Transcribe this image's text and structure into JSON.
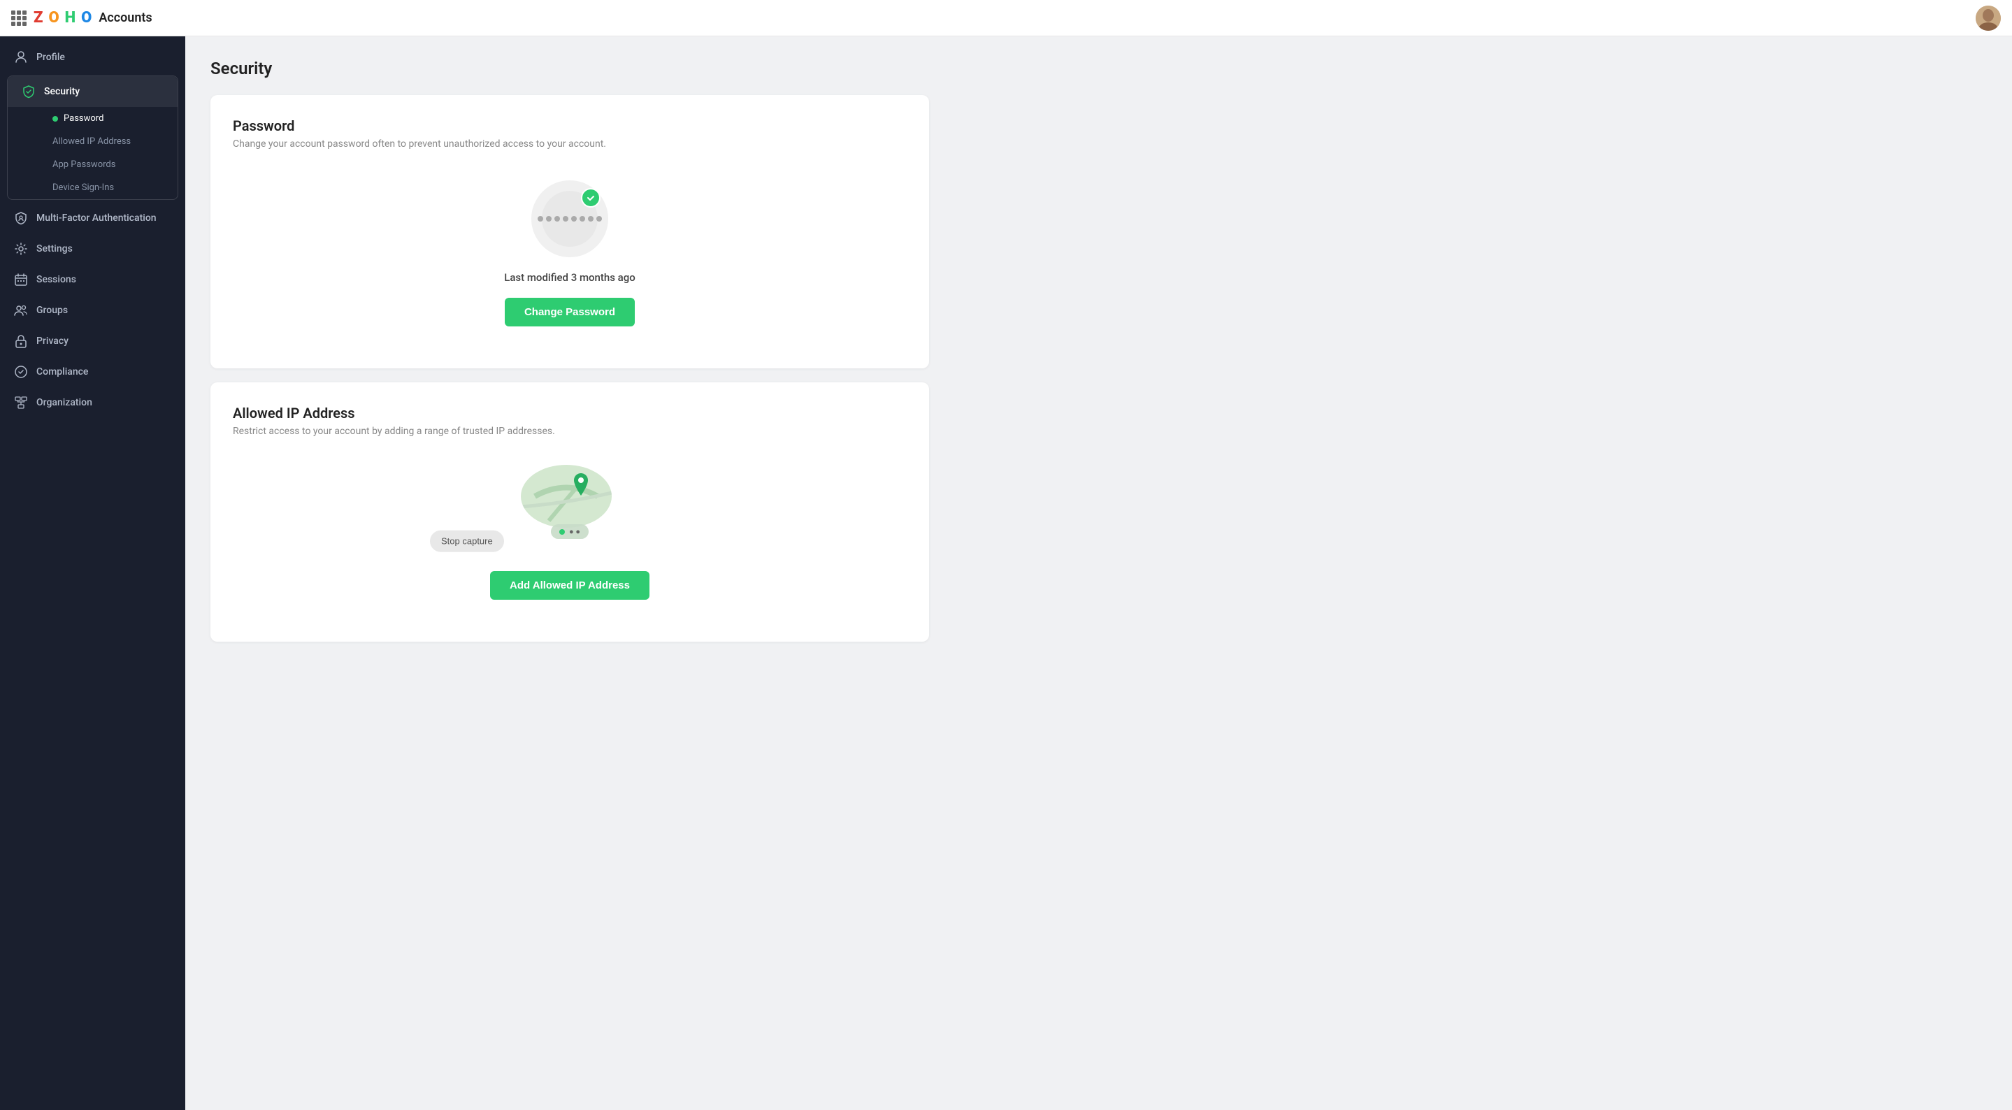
{
  "topbar": {
    "app_name": "Accounts",
    "logo_letters": "ZOHO"
  },
  "sidebar": {
    "items": [
      {
        "id": "profile",
        "label": "Profile",
        "icon": "person"
      },
      {
        "id": "security",
        "label": "Security",
        "icon": "shield",
        "active": true,
        "sub_items": [
          {
            "id": "password",
            "label": "Password",
            "active": true,
            "has_dot": true
          },
          {
            "id": "allowed-ip",
            "label": "Allowed IP Address",
            "active": false
          },
          {
            "id": "app-passwords",
            "label": "App Passwords",
            "active": false
          },
          {
            "id": "device-signins",
            "label": "Device Sign-Ins",
            "active": false
          }
        ]
      },
      {
        "id": "mfa",
        "label": "Multi-Factor Authentication",
        "icon": "shield-alt"
      },
      {
        "id": "settings",
        "label": "Settings",
        "icon": "gear"
      },
      {
        "id": "sessions",
        "label": "Sessions",
        "icon": "calendar"
      },
      {
        "id": "groups",
        "label": "Groups",
        "icon": "people"
      },
      {
        "id": "privacy",
        "label": "Privacy",
        "icon": "lock"
      },
      {
        "id": "compliance",
        "label": "Compliance",
        "icon": "compliance"
      },
      {
        "id": "organization",
        "label": "Organization",
        "icon": "org"
      }
    ]
  },
  "main": {
    "page_title": "Security",
    "password_card": {
      "title": "Password",
      "description": "Change your account password often to prevent unauthorized access to your account.",
      "last_modified": "Last modified 3 months ago",
      "change_button": "Change Password"
    },
    "ip_card": {
      "title": "Allowed IP Address",
      "description": "Restrict access to your account by adding a range of trusted IP addresses.",
      "add_button": "Add Allowed IP Address",
      "stop_capture": "Stop capture"
    }
  }
}
